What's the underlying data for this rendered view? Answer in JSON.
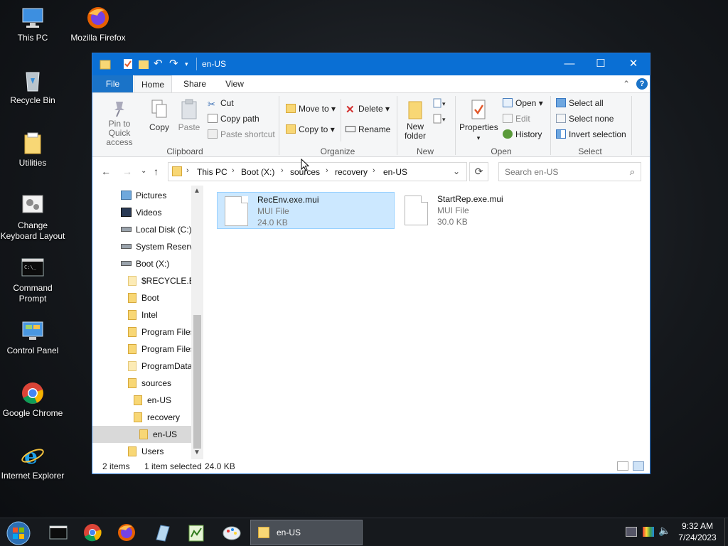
{
  "desktop": {
    "icons": [
      "This PC",
      "Mozilla Firefox",
      "Recycle Bin",
      "Utilities",
      "Change Keyboard Layout",
      "Command Prompt",
      "Control Panel",
      "Google Chrome",
      "Internet Explorer"
    ]
  },
  "window": {
    "title": "en-US",
    "minimize": "—",
    "maximize": "☐",
    "close": "✕",
    "help": "?",
    "up_arrow": "⌃"
  },
  "tabs": {
    "file": "File",
    "home": "Home",
    "share": "Share",
    "view": "View"
  },
  "ribbon": {
    "clipboard": {
      "pin": "Pin to Quick access",
      "copy": "Copy",
      "paste": "Paste",
      "cut": "Cut",
      "copy_path": "Copy path",
      "paste_shortcut": "Paste shortcut",
      "label": "Clipboard"
    },
    "organize": {
      "move_to": "Move to",
      "copy_to": "Copy to",
      "delete": "Delete",
      "rename": "Rename",
      "label": "Organize"
    },
    "new": {
      "new_folder": "New folder",
      "label": "New"
    },
    "open": {
      "properties": "Properties",
      "open": "Open",
      "edit": "Edit",
      "history": "History",
      "label": "Open"
    },
    "select": {
      "select_all": "Select all",
      "select_none": "Select none",
      "invert": "Invert selection",
      "label": "Select"
    }
  },
  "address": {
    "crumbs": [
      "This PC",
      "Boot (X:)",
      "sources",
      "recovery",
      "en-US"
    ],
    "search_placeholder": "Search en-US"
  },
  "navpane": {
    "items": [
      "Pictures",
      "Videos",
      "Local Disk (C:)",
      "System Reserve",
      "Boot (X:)",
      "$RECYCLE.BIN",
      "Boot",
      "Intel",
      "Program Files",
      "Program Files",
      "ProgramData",
      "sources",
      "en-US",
      "recovery",
      "en-US",
      "Users"
    ]
  },
  "files": [
    {
      "name": "RecEnv.exe.mui",
      "type": "MUI File",
      "size": "24.0 KB",
      "selected": true
    },
    {
      "name": "StartRep.exe.mui",
      "type": "MUI File",
      "size": "30.0 KB",
      "selected": false
    }
  ],
  "status": {
    "count": "2 items",
    "selected": "1 item selected",
    "size": "24.0 KB"
  },
  "taskbar": {
    "explorer_label": "en-US",
    "time": "9:32 AM",
    "date": "7/24/2023"
  },
  "colors": {
    "titlebar": "#0a6fd4",
    "selection": "#cce8ff",
    "folder": "#f8d775"
  }
}
